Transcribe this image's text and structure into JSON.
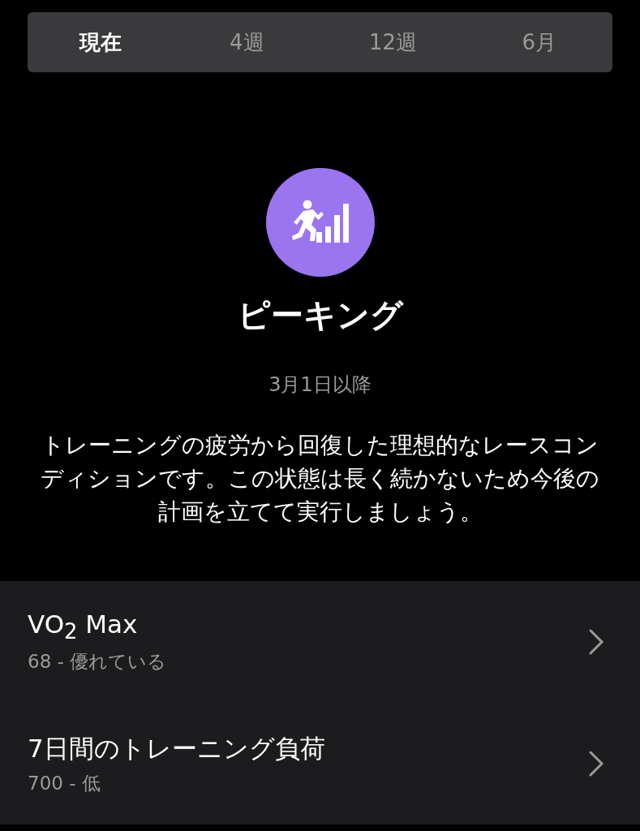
{
  "tabs": [
    {
      "label": "現在",
      "selected": true
    },
    {
      "label": "4週",
      "selected": false
    },
    {
      "label": "12週",
      "selected": false
    },
    {
      "label": "6月",
      "selected": false
    }
  ],
  "status": {
    "title": "ピーキング",
    "since": "3月1日以降",
    "description": "トレーニングの疲労から回復した理想的なレースコンディションです。この状態は長く続かないため今後の計画を立てて実行しましょう。"
  },
  "metrics": [
    {
      "name": "VO$_{2}$ Max",
      "value": "68 - 優れている"
    },
    {
      "name": "7日間のトレーニング負荷",
      "value": "700 - 低"
    }
  ]
}
